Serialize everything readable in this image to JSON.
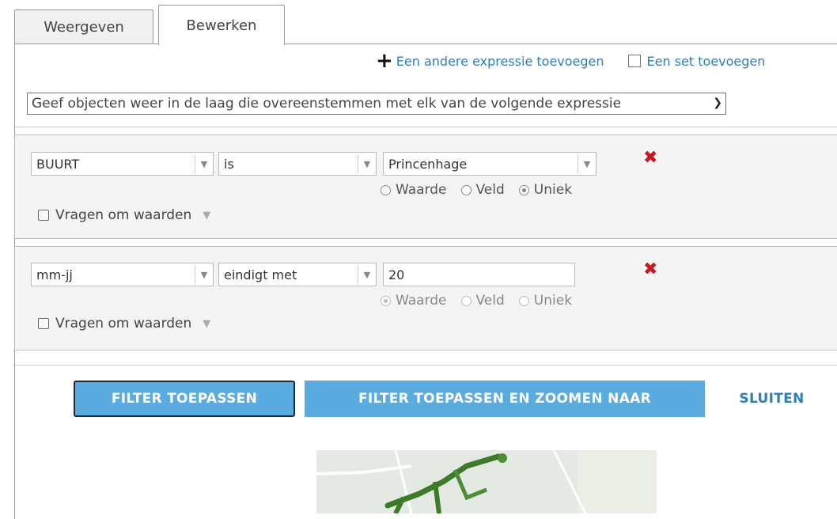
{
  "tabs": {
    "view": "Weergeven",
    "edit": "Bewerken"
  },
  "toolbar": {
    "add_expression": "Een andere expressie toevoegen",
    "add_set": "Een set toevoegen"
  },
  "match_select": {
    "value": "Geef objecten weer in de laag die overeenstemmen met elk van de volgende expressie"
  },
  "expressions": [
    {
      "field": "BUURT",
      "operator": "is",
      "value": "Princenhage",
      "radio_value": "Waarde",
      "radio_field": "Veld",
      "radio_unique": "Uniek",
      "selected": "Uniek",
      "ask": "Vragen om waarden"
    },
    {
      "field": "mm-jj",
      "operator": "eindigt met",
      "value": "20",
      "radio_value": "Waarde",
      "radio_field": "Veld",
      "radio_unique": "Uniek",
      "selected": "Waarde",
      "ask": "Vragen om waarden"
    }
  ],
  "buttons": {
    "apply": "FILTER TOEPASSEN",
    "apply_zoom": "FILTER TOEPASSEN EN ZOOMEN NAAR",
    "close": "SLUITEN"
  },
  "icons": {
    "plus": "plus-icon",
    "delete": "delete-x-icon",
    "dropdown": "chevron-down-icon"
  },
  "colors": {
    "accent": "#5aabdf",
    "link": "#2d7fb8",
    "delete": "#c8181d"
  }
}
